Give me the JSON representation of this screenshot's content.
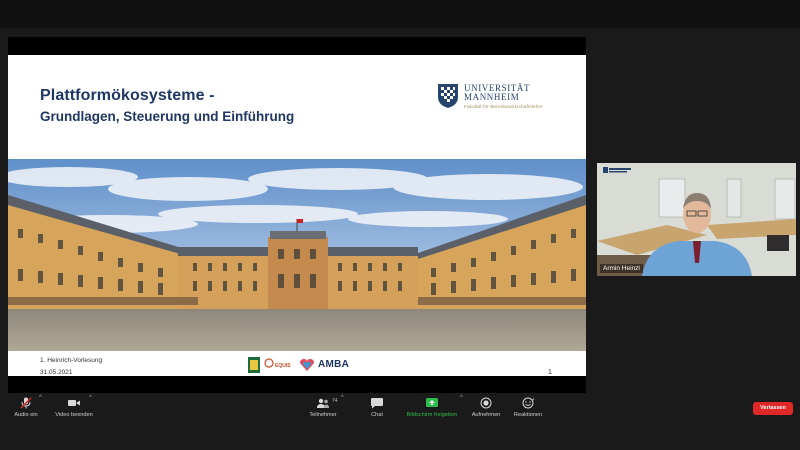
{
  "slide": {
    "title_line1": "Plattformökosysteme -",
    "title_line2": "Grundlagen, Steuerung und Einführung",
    "logo_line1": "UNIVERSITÄT",
    "logo_line2": "MANNHEIM",
    "logo_sub": "Fakultät für Betriebswirtschaftslehre",
    "footer_event": "1. Heinrich-Vorlesung",
    "footer_date": "31.05.2021",
    "page_number": "1",
    "partner_equis": "EQUIS",
    "partner_amba": "AMBA"
  },
  "participant": {
    "name": "Armin Heinzl"
  },
  "toolbar": {
    "audio_label": "Audio ein",
    "video_label": "Video beenden",
    "participants_label": "Teilnehmer",
    "participants_count": "74",
    "chat_label": "Chat",
    "share_label": "Bildschirm freigeben",
    "record_label": "Aufnehmen",
    "reactions_label": "Reaktionen",
    "leave_label": "Verlassen"
  },
  "colors": {
    "title": "#1f3763",
    "share_active": "#2dbe4c",
    "leave": "#e02828"
  }
}
